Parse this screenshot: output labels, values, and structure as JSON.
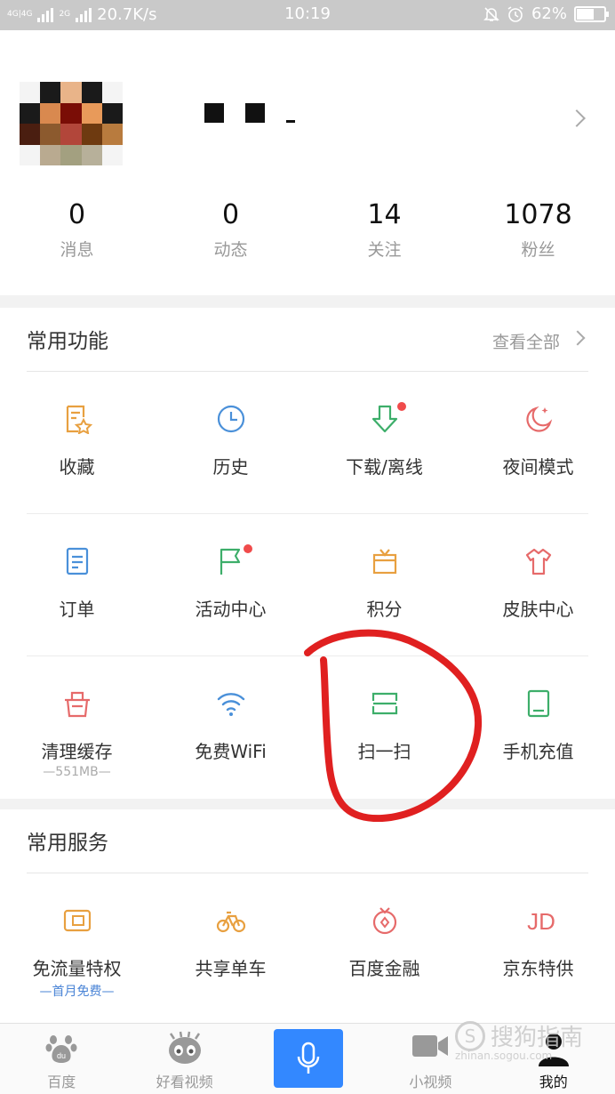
{
  "status_bar": {
    "net_left": "4G|4G",
    "net_right": "2G",
    "speed": "20.7K/s",
    "time": "10:19",
    "battery": "62%",
    "battery_level": 0.62,
    "icons": [
      "signal-icon",
      "mute-icon",
      "alarm-icon",
      "battery-icon"
    ]
  },
  "profile": {
    "stats": [
      {
        "value": "0",
        "label": "消息"
      },
      {
        "value": "0",
        "label": "动态"
      },
      {
        "value": "14",
        "label": "关注"
      },
      {
        "value": "1078",
        "label": "粉丝"
      }
    ]
  },
  "common_functions": {
    "title": "常用功能",
    "see_all": "查看全部",
    "items": [
      {
        "label": "收藏",
        "icon": "favorite-icon",
        "color": "#e8a040"
      },
      {
        "label": "历史",
        "icon": "clock-icon",
        "color": "#4a90d9"
      },
      {
        "label": "下载/离线",
        "icon": "download-icon",
        "color": "#3dae6a",
        "badge": true
      },
      {
        "label": "夜间模式",
        "icon": "moon-icon",
        "color": "#e66a6a"
      },
      {
        "label": "订单",
        "icon": "order-icon",
        "color": "#4a90d9"
      },
      {
        "label": "活动中心",
        "icon": "flag-icon",
        "color": "#3dae6a",
        "badge": true
      },
      {
        "label": "积分",
        "icon": "gift-icon",
        "color": "#e8a040"
      },
      {
        "label": "皮肤中心",
        "icon": "shirt-icon",
        "color": "#e66a6a"
      },
      {
        "label": "清理缓存",
        "sub": "—551MB—",
        "icon": "clean-basket-icon",
        "color": "#e66a6a"
      },
      {
        "label": "免费WiFi",
        "icon": "wifi-icon",
        "color": "#4a90d9"
      },
      {
        "label": "扫一扫",
        "icon": "scan-icon",
        "color": "#3dae6a"
      },
      {
        "label": "手机充值",
        "icon": "phone-book-icon",
        "color": "#3dae6a"
      }
    ]
  },
  "common_services": {
    "title": "常用服务",
    "items": [
      {
        "label": "免流量特权",
        "sub": "—首月免费—",
        "icon": "sim-card-icon",
        "color": "#e8a040"
      },
      {
        "label": "共享单车",
        "icon": "bicycle-icon",
        "color": "#e8a040"
      },
      {
        "label": "百度金融",
        "icon": "finance-icon",
        "color": "#e66a6a"
      },
      {
        "label": "京东特供",
        "icon": "jd-icon",
        "color": "#e66a6a",
        "icon_text": "JD"
      }
    ]
  },
  "annotation_color": "#e02020",
  "tabbar": {
    "items": [
      {
        "label": "百度",
        "icon": "baidu-paw-icon"
      },
      {
        "label": "好看视频",
        "icon": "haokan-icon"
      },
      {
        "label": "",
        "icon": "microphone-icon"
      },
      {
        "label": "小视频",
        "icon": "video-camera-icon"
      },
      {
        "label": "我的",
        "icon": "user-icon",
        "active": true
      }
    ]
  },
  "watermark": {
    "main": "搜狗指南",
    "url": "zhinan.sogou.com"
  }
}
